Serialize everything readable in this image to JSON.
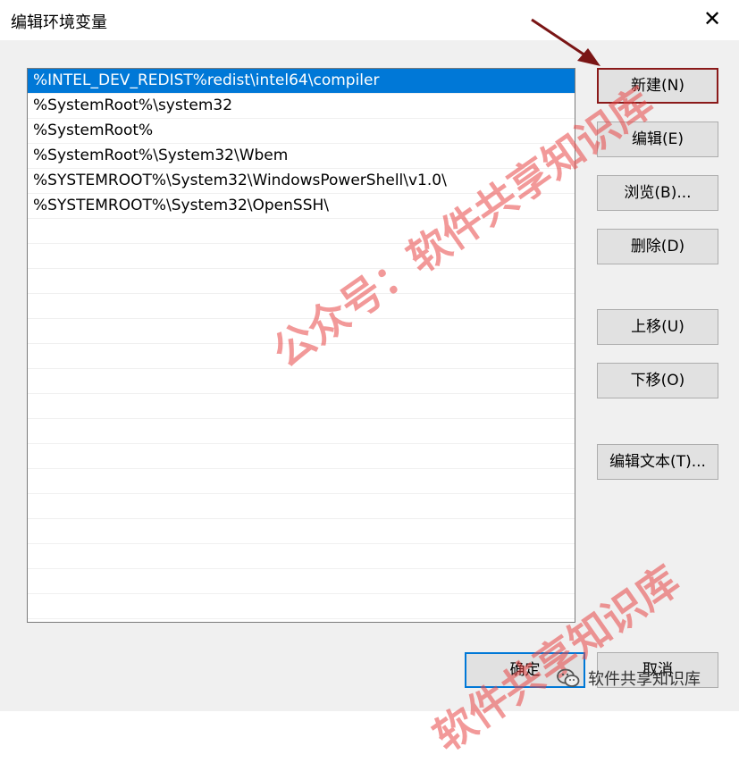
{
  "window": {
    "title": "编辑环境变量",
    "close_glyph": "✕"
  },
  "list": {
    "items": [
      "%INTEL_DEV_REDIST%redist\\intel64\\compiler",
      "%SystemRoot%\\system32",
      "%SystemRoot%",
      "%SystemRoot%\\System32\\Wbem",
      "%SYSTEMROOT%\\System32\\WindowsPowerShell\\v1.0\\",
      "%SYSTEMROOT%\\System32\\OpenSSH\\"
    ],
    "selected_index": 0
  },
  "buttons": {
    "new": "新建(N)",
    "edit": "编辑(E)",
    "browse": "浏览(B)...",
    "delete": "删除(D)",
    "move_up": "上移(U)",
    "move_down": "下移(O)",
    "edit_text": "编辑文本(T)...",
    "ok": "确定",
    "cancel": "取消"
  },
  "watermark": {
    "text1": "公众号：软件共享知识库",
    "text2": "软件共享知识库",
    "footer": "软件共享知识库"
  },
  "colors": {
    "selection": "#0078d7",
    "highlight_border": "#8b1a1a",
    "watermark": "#e84646"
  }
}
